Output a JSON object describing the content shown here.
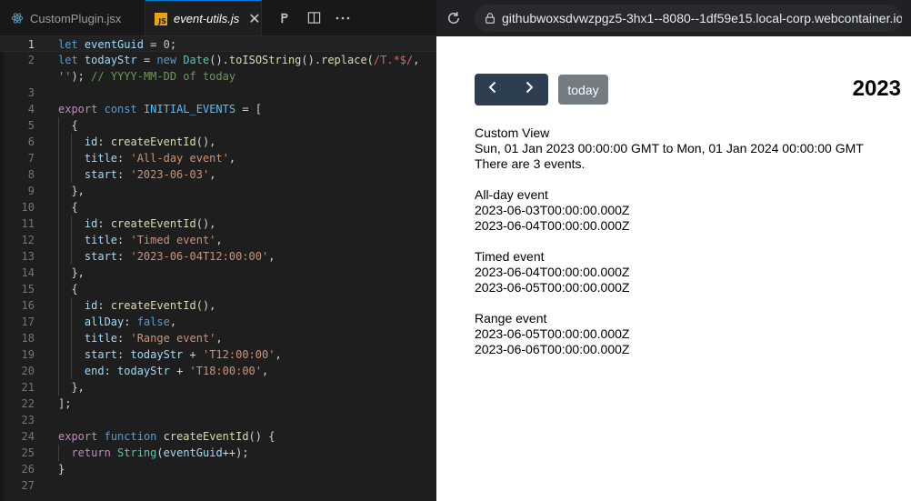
{
  "tabs": [
    {
      "label": "CustomPlugin.jsx",
      "active": false,
      "icon": "react-icon"
    },
    {
      "label": "event-utils.js",
      "active": true,
      "icon": "js-file-icon",
      "badge": "JS"
    }
  ],
  "editor_actions": [
    "git-compare-icon",
    "split-editor-icon",
    "more-actions-icon"
  ],
  "browser": {
    "url": "githubwoxsdvwzpgz5-3hx1--8080--1df59e15.local-corp.webcontainer.io"
  },
  "code": {
    "current_line": 1,
    "lines": [
      {
        "n": "1",
        "tokens": [
          [
            "kw",
            "let"
          ],
          [
            "p",
            " "
          ],
          [
            "var",
            "eventGuid"
          ],
          [
            "p",
            " = "
          ],
          [
            "num",
            "0"
          ],
          [
            "p",
            ";"
          ]
        ]
      },
      {
        "n": "2",
        "tokens": [
          [
            "kw",
            "let"
          ],
          [
            "p",
            " "
          ],
          [
            "var",
            "todayStr"
          ],
          [
            "p",
            " = "
          ],
          [
            "kw",
            "new"
          ],
          [
            "p",
            " "
          ],
          [
            "cls",
            "Date"
          ],
          [
            "p",
            "()."
          ],
          [
            "fn",
            "toISOString"
          ],
          [
            "p",
            "()."
          ],
          [
            "fn",
            "replace"
          ],
          [
            "p",
            "("
          ],
          [
            "re",
            "/T.*$/"
          ],
          [
            "p",
            ","
          ]
        ]
      },
      {
        "n": "",
        "tokens": [
          [
            "str",
            "''"
          ],
          [
            "p",
            "); "
          ],
          [
            "cmt",
            "// YYYY-MM-DD of today"
          ]
        ]
      },
      {
        "n": "3",
        "tokens": []
      },
      {
        "n": "4",
        "tokens": [
          [
            "ctl",
            "export"
          ],
          [
            "p",
            " "
          ],
          [
            "kw",
            "const"
          ],
          [
            "p",
            " "
          ],
          [
            "cst",
            "INITIAL_EVENTS"
          ],
          [
            "p",
            " = ["
          ]
        ]
      },
      {
        "n": "5",
        "tokens": [
          [
            "p",
            "  {"
          ]
        ]
      },
      {
        "n": "6",
        "tokens": [
          [
            "p",
            "    "
          ],
          [
            "var",
            "id"
          ],
          [
            "p",
            ": "
          ],
          [
            "fn",
            "createEventId"
          ],
          [
            "p",
            "(),"
          ]
        ]
      },
      {
        "n": "7",
        "tokens": [
          [
            "p",
            "    "
          ],
          [
            "var",
            "title"
          ],
          [
            "p",
            ": "
          ],
          [
            "str",
            "'All-day event'"
          ],
          [
            "p",
            ","
          ]
        ]
      },
      {
        "n": "8",
        "tokens": [
          [
            "p",
            "    "
          ],
          [
            "var",
            "start"
          ],
          [
            "p",
            ": "
          ],
          [
            "str",
            "'2023-06-03'"
          ],
          [
            "p",
            ","
          ]
        ]
      },
      {
        "n": "9",
        "tokens": [
          [
            "p",
            "  },"
          ]
        ]
      },
      {
        "n": "10",
        "tokens": [
          [
            "p",
            "  {"
          ]
        ]
      },
      {
        "n": "11",
        "tokens": [
          [
            "p",
            "    "
          ],
          [
            "var",
            "id"
          ],
          [
            "p",
            ": "
          ],
          [
            "fn",
            "createEventId"
          ],
          [
            "p",
            "(),"
          ]
        ]
      },
      {
        "n": "12",
        "tokens": [
          [
            "p",
            "    "
          ],
          [
            "var",
            "title"
          ],
          [
            "p",
            ": "
          ],
          [
            "str",
            "'Timed event'"
          ],
          [
            "p",
            ","
          ]
        ]
      },
      {
        "n": "13",
        "tokens": [
          [
            "p",
            "    "
          ],
          [
            "var",
            "start"
          ],
          [
            "p",
            ": "
          ],
          [
            "str",
            "'2023-06-04T12:00:00'"
          ],
          [
            "p",
            ","
          ]
        ]
      },
      {
        "n": "14",
        "tokens": [
          [
            "p",
            "  },"
          ]
        ]
      },
      {
        "n": "15",
        "tokens": [
          [
            "p",
            "  {"
          ]
        ]
      },
      {
        "n": "16",
        "tokens": [
          [
            "p",
            "    "
          ],
          [
            "var",
            "id"
          ],
          [
            "p",
            ": "
          ],
          [
            "fn",
            "createEventId"
          ],
          [
            "p",
            "(),"
          ]
        ]
      },
      {
        "n": "17",
        "tokens": [
          [
            "p",
            "    "
          ],
          [
            "var",
            "allDay"
          ],
          [
            "p",
            ": "
          ],
          [
            "kw",
            "false"
          ],
          [
            "p",
            ","
          ]
        ]
      },
      {
        "n": "18",
        "tokens": [
          [
            "p",
            "    "
          ],
          [
            "var",
            "title"
          ],
          [
            "p",
            ": "
          ],
          [
            "str",
            "'Range event'"
          ],
          [
            "p",
            ","
          ]
        ]
      },
      {
        "n": "19",
        "tokens": [
          [
            "p",
            "    "
          ],
          [
            "var",
            "start"
          ],
          [
            "p",
            ": "
          ],
          [
            "var",
            "todayStr"
          ],
          [
            "p",
            " + "
          ],
          [
            "str",
            "'T12:00:00'"
          ],
          [
            "p",
            ","
          ]
        ]
      },
      {
        "n": "20",
        "tokens": [
          [
            "p",
            "    "
          ],
          [
            "var",
            "end"
          ],
          [
            "p",
            ": "
          ],
          [
            "var",
            "todayStr"
          ],
          [
            "p",
            " + "
          ],
          [
            "str",
            "'T18:00:00'"
          ],
          [
            "p",
            ","
          ]
        ]
      },
      {
        "n": "21",
        "tokens": [
          [
            "p",
            "  },"
          ]
        ]
      },
      {
        "n": "22",
        "tokens": [
          [
            "p",
            "];"
          ]
        ]
      },
      {
        "n": "23",
        "tokens": []
      },
      {
        "n": "24",
        "tokens": [
          [
            "ctl",
            "export"
          ],
          [
            "p",
            " "
          ],
          [
            "kw",
            "function"
          ],
          [
            "p",
            " "
          ],
          [
            "fn",
            "createEventId"
          ],
          [
            "p",
            "() {"
          ]
        ]
      },
      {
        "n": "25",
        "tokens": [
          [
            "p",
            "  "
          ],
          [
            "ctl",
            "return"
          ],
          [
            "p",
            " "
          ],
          [
            "cls",
            "String"
          ],
          [
            "p",
            "("
          ],
          [
            "var",
            "eventGuid"
          ],
          [
            "p",
            "++);"
          ]
        ]
      },
      {
        "n": "26",
        "tokens": [
          [
            "p",
            "}"
          ]
        ]
      },
      {
        "n": "27",
        "tokens": []
      }
    ]
  },
  "calendar": {
    "prev_icon": "chevron-left-icon",
    "next_icon": "chevron-right-icon",
    "today_label": "today",
    "title": "2023",
    "view_name": "Custom View",
    "range": "Sun, 01 Jan 2023 00:00:00 GMT to Mon, 01 Jan 2024 00:00:00 GMT",
    "count_text": "There are 3 events.",
    "events": [
      {
        "title": "All-day event",
        "start": "2023-06-03T00:00:00.000Z",
        "end": "2023-06-04T00:00:00.000Z"
      },
      {
        "title": "Timed event",
        "start": "2023-06-04T00:00:00.000Z",
        "end": "2023-06-05T00:00:00.000Z"
      },
      {
        "title": "Range event",
        "start": "2023-06-05T00:00:00.000Z",
        "end": "2023-06-06T00:00:00.000Z"
      }
    ]
  }
}
